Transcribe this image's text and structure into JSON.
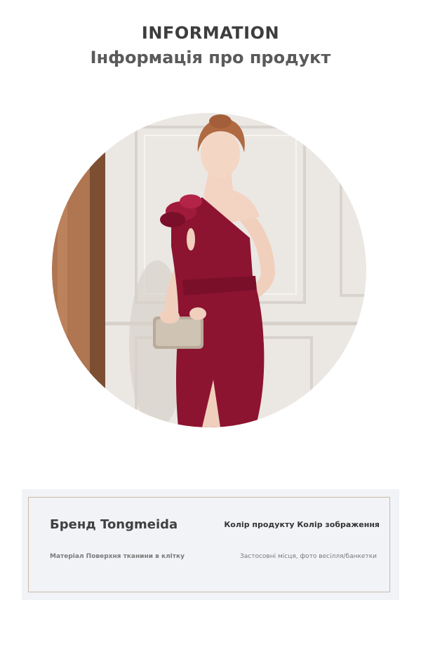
{
  "header": {
    "title_en": "INFORMATION",
    "title_uk": "Інформація про продукт"
  },
  "product_info": {
    "brand": "Бренд Tongmeida",
    "color": "Колір продукту Колір зображення",
    "material": "Матеріал Поверхня тканини в клітку",
    "usage": "Застосовні місця, фото весілля/банкетки"
  },
  "colors": {
    "dress": "#8c1431",
    "wall": "#eeeae6",
    "curtain": "#b97c54",
    "panel_bg": "#f1f3f6",
    "panel_border": "#c9b9a8"
  }
}
